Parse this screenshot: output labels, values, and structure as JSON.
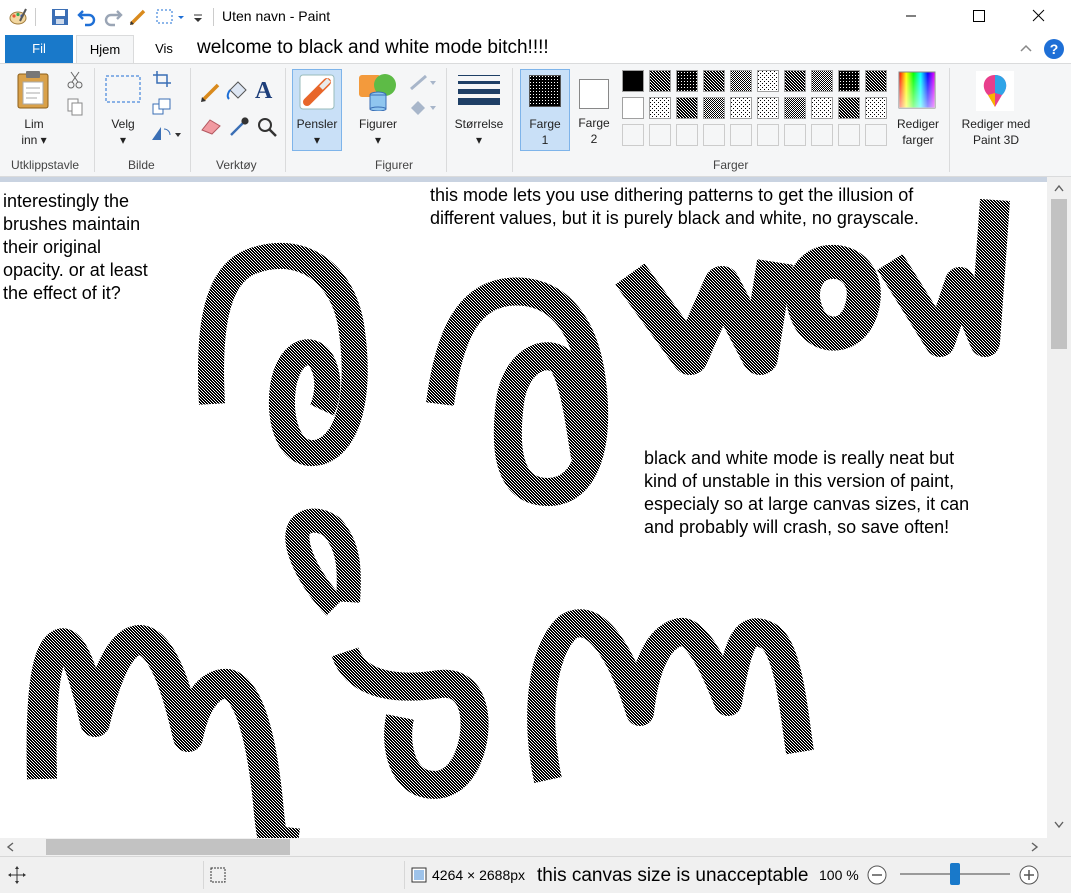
{
  "window": {
    "title": "Uten navn - Paint"
  },
  "tabs": {
    "file": "Fil",
    "home": "Hjem",
    "view": "Vis",
    "annotation": "welcome to black and white mode bitch!!!!"
  },
  "ribbon": {
    "clipboard": {
      "paste_label_1": "Lim",
      "paste_label_2": "inn",
      "group": "Utklippstavle"
    },
    "image": {
      "select_label": "Velg",
      "group": "Bilde"
    },
    "tools": {
      "group": "Verktøy",
      "text_glyph": "A"
    },
    "brushes": {
      "label": "Pensler"
    },
    "shapes": {
      "label": "Figurer",
      "group": "Figurer"
    },
    "size": {
      "label": "Størrelse"
    },
    "colors": {
      "color1_label_1": "Farge",
      "color1_label_2": "1",
      "color2_label_1": "Farge",
      "color2_label_2": "2",
      "edit_label_1": "Rediger",
      "edit_label_2": "farger",
      "group": "Farger"
    },
    "paint3d": {
      "label_1": "Rediger med",
      "label_2": "Paint 3D"
    }
  },
  "canvas": {
    "note1": [
      "interestingly the",
      "brushes maintain",
      "their original",
      "opacity. or at least",
      "the effect of it?"
    ],
    "note2": [
      "this mode lets you use dithering patterns to get the illusion of",
      "different values, but it is purely black and white, no grayscale."
    ],
    "note3": [
      "black and white mode is really neat but",
      "kind of unstable in this version of paint,",
      "especialy so at large canvas sizes, it can",
      "and probably will crash, so save often!"
    ]
  },
  "statusbar": {
    "dimensions": "4264 × 2688px",
    "annotation": "this canvas size is unacceptable",
    "zoom": "100 %",
    "zoom_level_percent": 100
  },
  "colors": {
    "accent": "#1979ca",
    "ribbon_bg": "#f5f6f7",
    "active_tool": "#c9e0f7",
    "canvas_bg": "#c9d3e1"
  }
}
